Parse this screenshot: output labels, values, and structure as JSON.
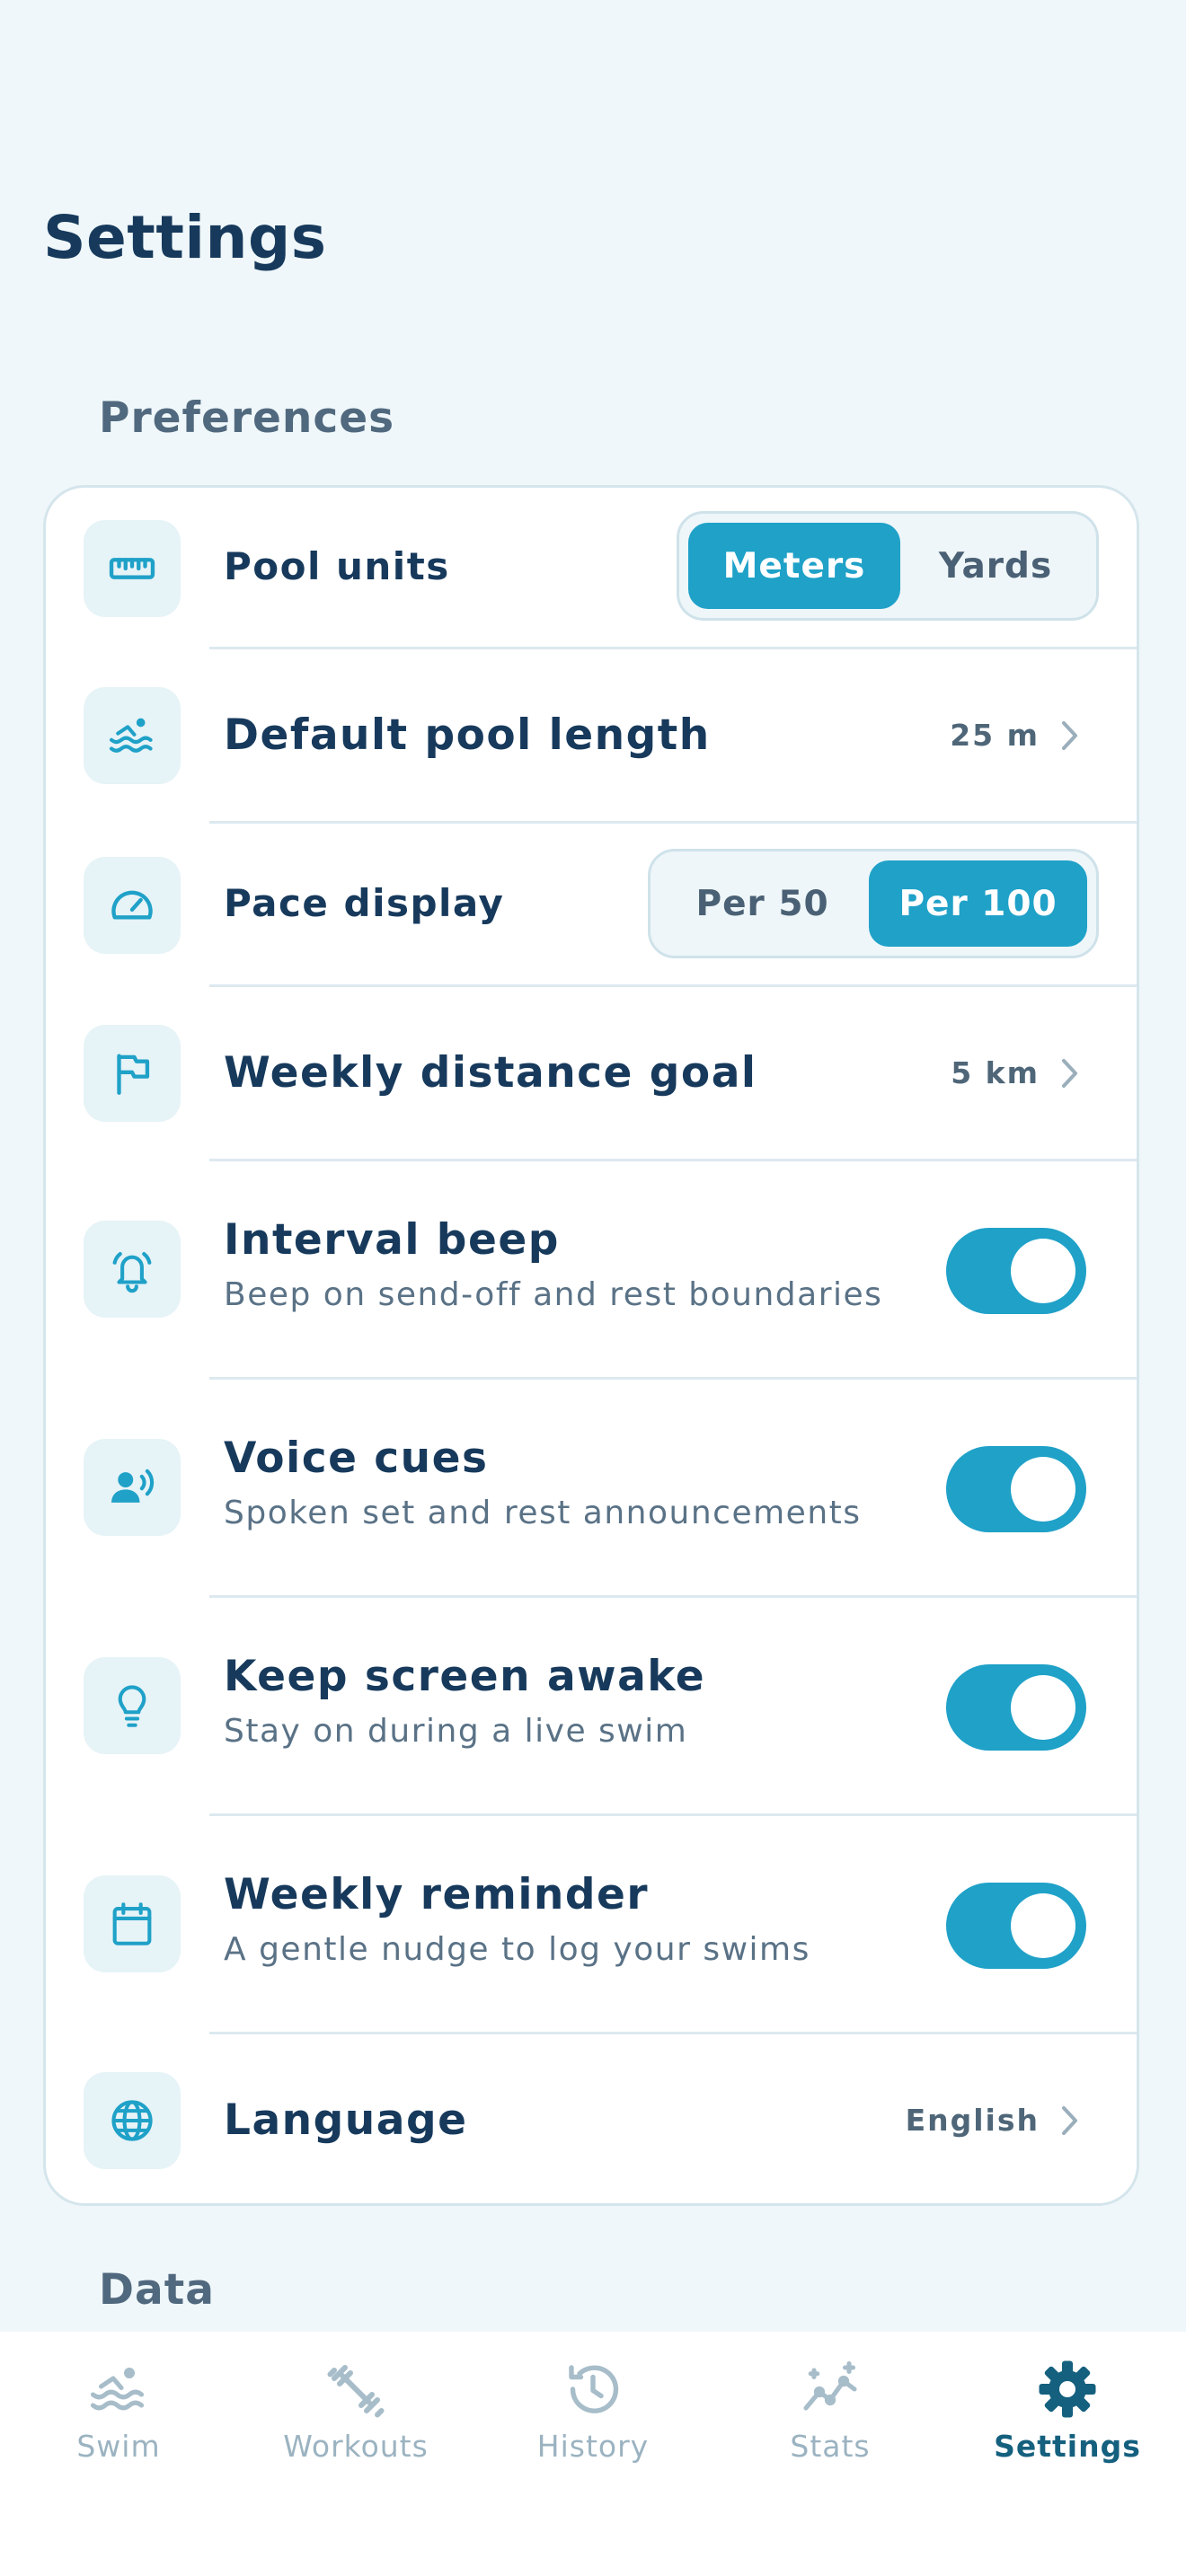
{
  "page": {
    "title": "Settings"
  },
  "sections": {
    "preferences": "Preferences",
    "data": "Data"
  },
  "colors": {
    "accent": "#1FA1C8",
    "text": "#173A5C",
    "muted": "#5A7286",
    "background": "#EFF7FA",
    "active_tab": "#14607E"
  },
  "rows": {
    "pool_units": {
      "icon": "ruler-icon",
      "title": "Pool units",
      "options": [
        "Meters",
        "Yards"
      ],
      "selected": "Meters"
    },
    "pool_length": {
      "icon": "swimmer-icon",
      "title": "Default pool length",
      "value": "25 m"
    },
    "pace_display": {
      "icon": "speedometer-icon",
      "title": "Pace display",
      "options": [
        "Per 50",
        "Per 100"
      ],
      "selected": "Per 100"
    },
    "distance_goal": {
      "icon": "flag-icon",
      "title": "Weekly distance goal",
      "value": "5 km"
    },
    "interval_beep": {
      "icon": "bell-ringing-icon",
      "title": "Interval beep",
      "subtitle": "Beep on send-off and rest boundaries",
      "enabled": true
    },
    "voice_cues": {
      "icon": "person-speaking-icon",
      "title": "Voice cues",
      "subtitle": "Spoken set and rest announcements",
      "enabled": true
    },
    "screen_awake": {
      "icon": "lightbulb-icon",
      "title": "Keep screen awake",
      "subtitle": "Stay on during a live swim",
      "enabled": true
    },
    "weekly_reminder": {
      "icon": "calendar-icon",
      "title": "Weekly reminder",
      "subtitle": "A gentle nudge to log your swims",
      "enabled": true
    },
    "language": {
      "icon": "globe-icon",
      "title": "Language",
      "value": "English"
    }
  },
  "tabs": [
    {
      "label": "Swim",
      "icon": "swimmer-icon"
    },
    {
      "label": "Workouts",
      "icon": "dumbbell-icon"
    },
    {
      "label": "History",
      "icon": "history-icon"
    },
    {
      "label": "Stats",
      "icon": "stats-sparkle-icon"
    },
    {
      "label": "Settings",
      "icon": "gear-icon",
      "active": true
    }
  ]
}
